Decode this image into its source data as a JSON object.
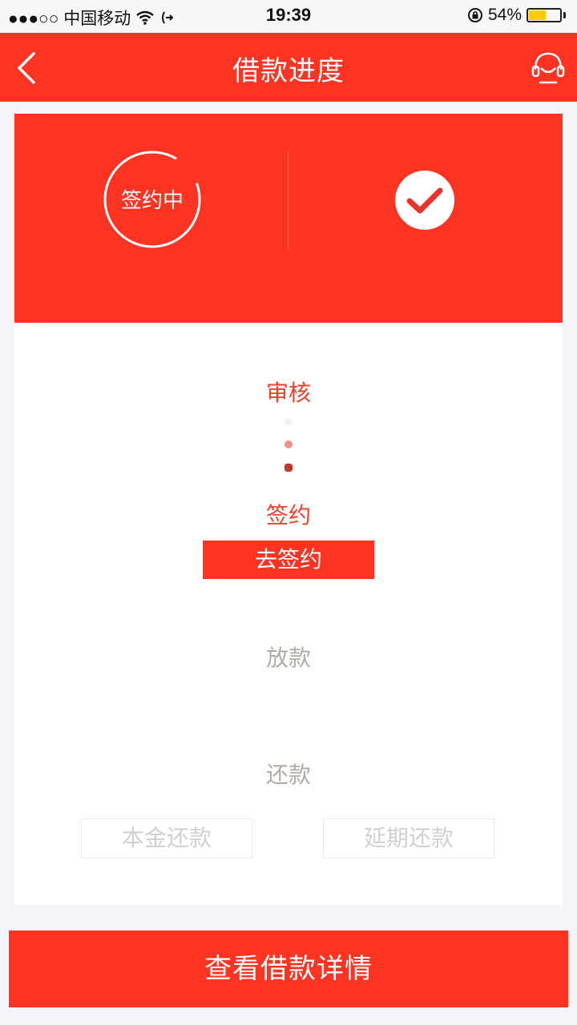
{
  "status_bar": {
    "carrier": "●●●○○ 中国移动",
    "time": "19:39",
    "battery_percent": "54%",
    "battery_level": 0.54,
    "icons": [
      "signal-dots-icon",
      "wifi-icon",
      "call-forward-icon",
      "rotation-lock-icon",
      "battery-icon"
    ]
  },
  "navbar": {
    "title": "借款进度",
    "back_icon": "chevron-left-icon",
    "service_icon": "headset-icon"
  },
  "hero": {
    "status_text": "签约中",
    "check_icon": "check-circle-icon",
    "colors": {
      "background": "#ff3322"
    }
  },
  "progress": {
    "steps": [
      {
        "label": "审核",
        "state": "active"
      },
      {
        "label": "签约",
        "state": "active"
      },
      {
        "label": "放款",
        "state": "inactive"
      },
      {
        "label": "还款",
        "state": "inactive"
      }
    ],
    "sign_button": "去签约",
    "repay_buttons": [
      "本金还款",
      "延期还款"
    ]
  },
  "footer": {
    "detail_button": "查看借款详情"
  },
  "colors": {
    "accent": "#ff3322",
    "active_text": "#f0402a",
    "inactive_text": "#b3aaa6",
    "page_bg": "#f5f4f9"
  }
}
